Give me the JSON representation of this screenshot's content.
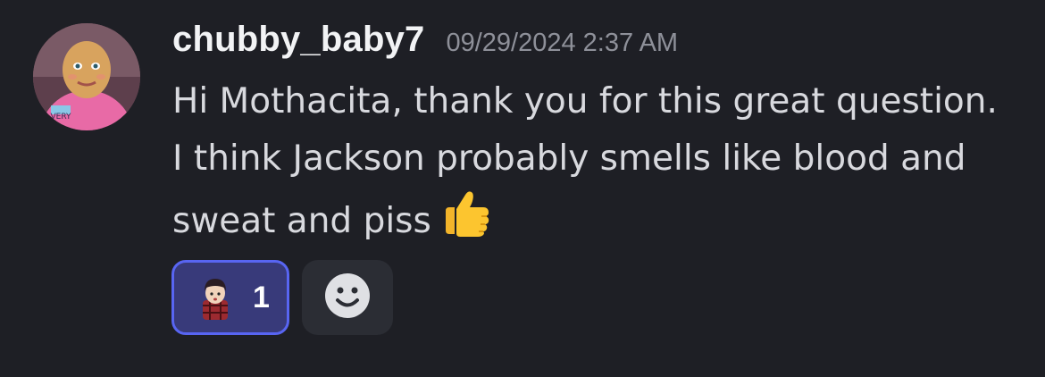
{
  "message": {
    "username": "chubby_baby7",
    "timestamp": "09/29/2024 2:37 AM",
    "text": "Hi Mothacita, thank you for this great question. I think Jackson probably smells like blood and sweat and piss",
    "inline_emoji": "thumbs-up"
  },
  "reactions": [
    {
      "emoji": "custom-character-emoji",
      "count": "1",
      "selected": true
    }
  ],
  "add_reaction": {
    "icon": "smiley-add-reaction-icon"
  },
  "colors": {
    "background": "#1e1f25",
    "accent": "#5865f2",
    "reaction_selected_bg": "#383a7a",
    "username": "#f2f3f5",
    "timestamp": "#8e9099",
    "text": "#d8d9de"
  }
}
